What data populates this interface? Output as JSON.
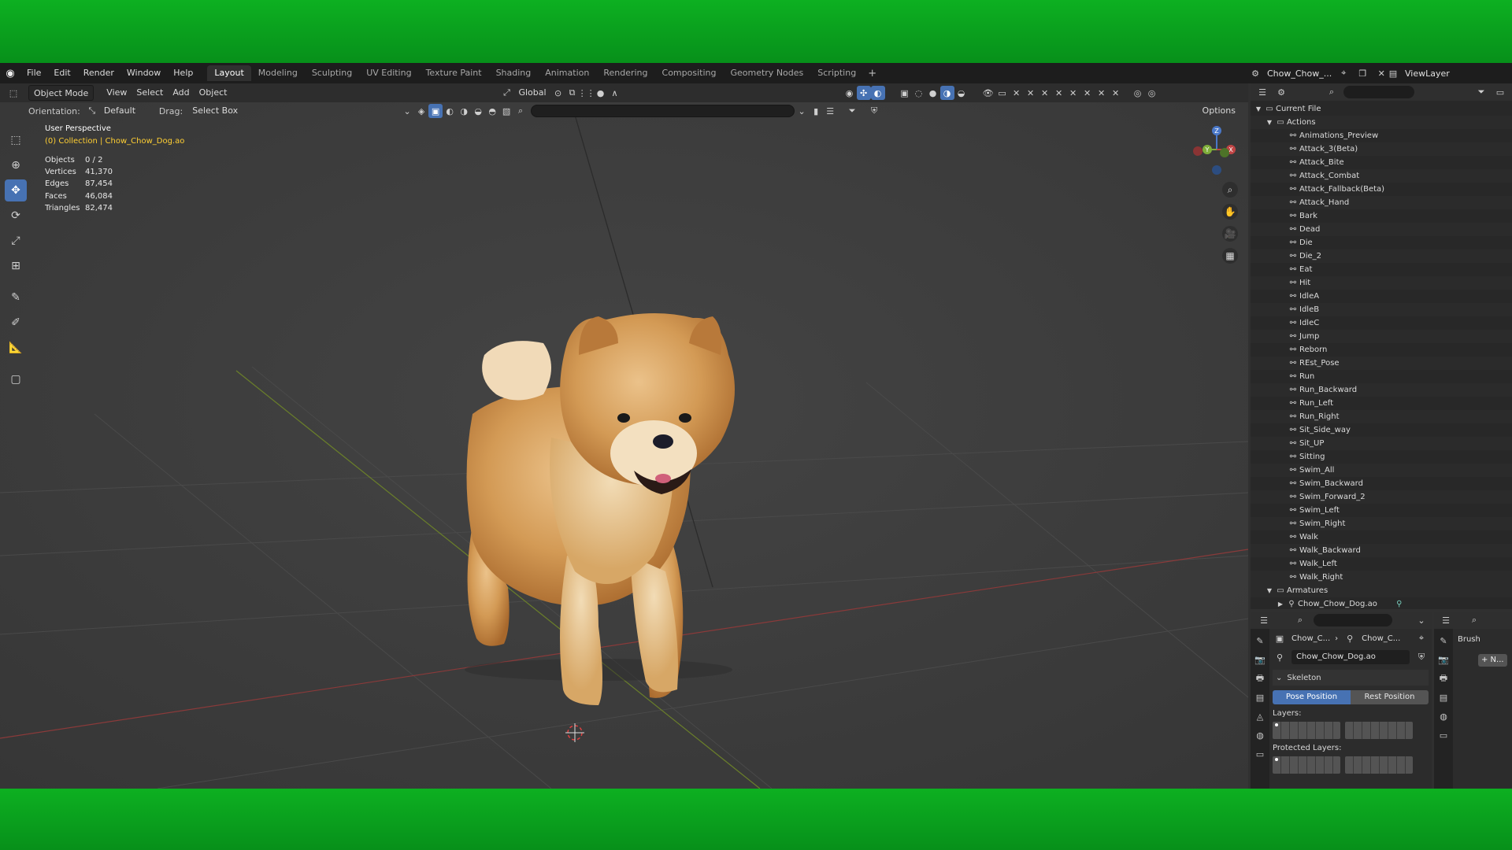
{
  "menu": [
    "File",
    "Edit",
    "Render",
    "Window",
    "Help"
  ],
  "workspaces": [
    "Layout",
    "Modeling",
    "Sculpting",
    "UV Editing",
    "Texture Paint",
    "Shading",
    "Animation",
    "Rendering",
    "Compositing",
    "Geometry Nodes",
    "Scripting"
  ],
  "scene_name": "Chow_Chow_...",
  "view_layer": "ViewLayer",
  "viewport": {
    "mode": "Object Mode",
    "header_menus": [
      "View",
      "Select",
      "Add",
      "Object"
    ],
    "transform_orientation": "Global",
    "orientation_label": "Orientation:",
    "orientation_value": "Default",
    "drag_label": "Drag:",
    "drag_value": "Select Box",
    "options_label": "Options",
    "perspective": "User Perspective",
    "collection": "(0) Collection | Chow_Chow_Dog.ao",
    "stats": [
      {
        "label": "Objects",
        "value": "0 / 2"
      },
      {
        "label": "Vertices",
        "value": "41,370"
      },
      {
        "label": "Edges",
        "value": "87,454"
      },
      {
        "label": "Faces",
        "value": "46,084"
      },
      {
        "label": "Triangles",
        "value": "82,474"
      }
    ]
  },
  "outliner": {
    "root": "Current File",
    "actions_label": "Actions",
    "actions": [
      "Animations_Preview",
      "Attack_3(Beta)",
      "Attack_Bite",
      "Attack_Combat",
      "Attack_Fallback(Beta)",
      "Attack_Hand",
      "Bark",
      "Dead",
      "Die",
      "Die_2",
      "Eat",
      "Hit",
      "IdleA",
      "IdleB",
      "IdleC",
      "Jump",
      "Reborn",
      "REst_Pose",
      "Run",
      "Run_Backward",
      "Run_Left",
      "Run_Right",
      "Sit_Side_way",
      "Sit_UP",
      "Sitting",
      "Swim_All",
      "Swim_Backward",
      "Swim_Forward_2",
      "Swim_Left",
      "Swim_Right",
      "Walk",
      "Walk_Backward",
      "Walk_Left",
      "Walk_Right"
    ],
    "armatures_label": "Armatures",
    "armature_item": "Chow_Chow_Dog.ao"
  },
  "properties": {
    "breadcrumb_1": "Chow_C...",
    "breadcrumb_2": "Chow_C...",
    "data_name": "Chow_Chow_Dog.ao",
    "panel": "Skeleton",
    "pose_position": "Pose Position",
    "rest_position": "Rest Position",
    "layers_label": "Layers:",
    "protected_layers_label": "Protected Layers:"
  },
  "tool_props": {
    "brush": "Brush",
    "new": "+ N..."
  },
  "colors": {
    "accent": "#4772b3",
    "collection_text": "#ffcf33",
    "chroma_green": "#0a9c1c"
  }
}
